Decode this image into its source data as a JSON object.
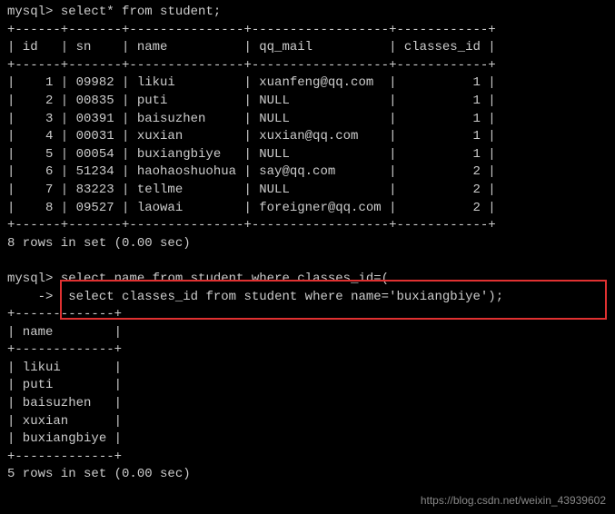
{
  "query1": {
    "prompt": "mysql>",
    "sql": "select* from student;",
    "border_top": "+------+-------+---------------+------------------+------------+",
    "header_row": "| id   | sn    | name          | qq_mail          | classes_id |",
    "border_mid": "+------+-------+---------------+------------------+------------+",
    "rows": [
      "|    1 | 09982 | likui         | xuanfeng@qq.com  |          1 |",
      "|    2 | 00835 | puti          | NULL             |          1 |",
      "|    3 | 00391 | baisuzhen     | NULL             |          1 |",
      "|    4 | 00031 | xuxian        | xuxian@qq.com    |          1 |",
      "|    5 | 00054 | buxiangbiye   | NULL             |          1 |",
      "|    6 | 51234 | haohaoshuohua | say@qq.com       |          2 |",
      "|    7 | 83223 | tellme        | NULL             |          2 |",
      "|    8 | 09527 | laowai        | foreigner@qq.com |          2 |"
    ],
    "border_bot": "+------+-------+---------------+------------------+------------+",
    "result_msg": "8 rows in set (0.00 sec)"
  },
  "query2": {
    "prompt": "mysql>",
    "cont_prompt": "    ->",
    "sql_line1": "select name from student where classes_id=(",
    "sql_line2": " select classes_id from student where name='buxiangbiye');",
    "border_top": "+-------------+",
    "header_row": "| name        |",
    "border_mid": "+-------------+",
    "rows": [
      "| likui       |",
      "| puti        |",
      "| baisuzhen   |",
      "| xuxian      |",
      "| buxiangbiye |"
    ],
    "border_bot": "+-------------+",
    "result_msg": "5 rows in set (0.00 sec)"
  },
  "watermark": "https://blog.csdn.net/weixin_43939602"
}
